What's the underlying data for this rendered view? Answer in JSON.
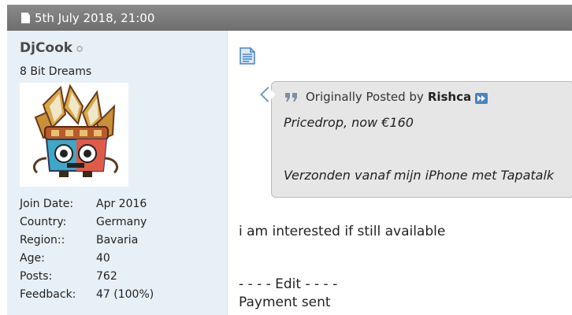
{
  "post": {
    "date": "5th July 2018, 21:00"
  },
  "user": {
    "name": "DjCook",
    "title": "8 Bit Dreams",
    "stats": [
      {
        "label": "Join Date:",
        "value": "Apr 2016"
      },
      {
        "label": "Country:",
        "value": "Germany"
      },
      {
        "label": "Region::",
        "value": "Bavaria"
      },
      {
        "label": "Age:",
        "value": "40"
      },
      {
        "label": "Posts:",
        "value": "762"
      },
      {
        "label": "Feedback:",
        "value": "47 (100%)"
      }
    ]
  },
  "quote": {
    "prefix": "Originally Posted by",
    "author": "Rishca",
    "line1": "Pricedrop, now €160",
    "line2": "Verzonden vanaf mijn iPhone met Tapatalk"
  },
  "message": {
    "line1": "i am interested if still available",
    "line2": "- - - - Edit - - - -",
    "line3": "Payment sent"
  },
  "colors": {
    "header_bg": "#777777",
    "userinfo_bg": "#e8f0f7",
    "quote_bg": "#e6e6e6",
    "accent_blue": "#4a84c0"
  }
}
